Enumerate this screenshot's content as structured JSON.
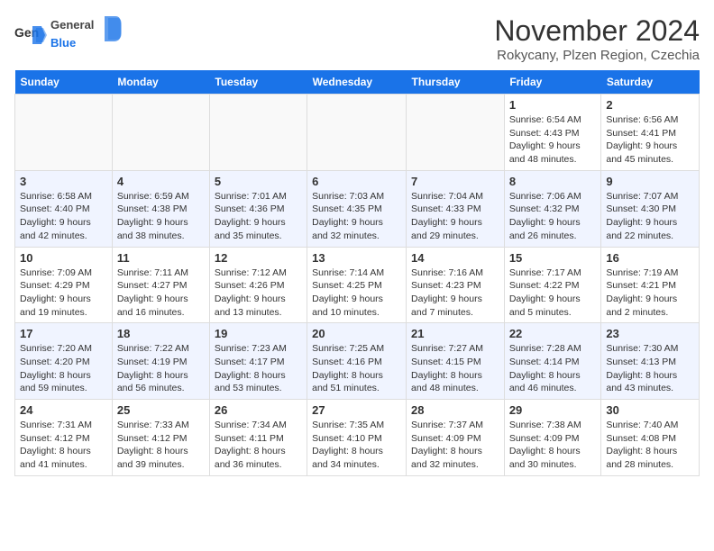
{
  "logo": {
    "general": "General",
    "blue": "Blue"
  },
  "title": "November 2024",
  "location": "Rokycany, Plzen Region, Czechia",
  "days_of_week": [
    "Sunday",
    "Monday",
    "Tuesday",
    "Wednesday",
    "Thursday",
    "Friday",
    "Saturday"
  ],
  "weeks": [
    [
      {
        "day": "",
        "info": ""
      },
      {
        "day": "",
        "info": ""
      },
      {
        "day": "",
        "info": ""
      },
      {
        "day": "",
        "info": ""
      },
      {
        "day": "",
        "info": ""
      },
      {
        "day": "1",
        "info": "Sunrise: 6:54 AM\nSunset: 4:43 PM\nDaylight: 9 hours\nand 48 minutes."
      },
      {
        "day": "2",
        "info": "Sunrise: 6:56 AM\nSunset: 4:41 PM\nDaylight: 9 hours\nand 45 minutes."
      }
    ],
    [
      {
        "day": "3",
        "info": "Sunrise: 6:58 AM\nSunset: 4:40 PM\nDaylight: 9 hours\nand 42 minutes."
      },
      {
        "day": "4",
        "info": "Sunrise: 6:59 AM\nSunset: 4:38 PM\nDaylight: 9 hours\nand 38 minutes."
      },
      {
        "day": "5",
        "info": "Sunrise: 7:01 AM\nSunset: 4:36 PM\nDaylight: 9 hours\nand 35 minutes."
      },
      {
        "day": "6",
        "info": "Sunrise: 7:03 AM\nSunset: 4:35 PM\nDaylight: 9 hours\nand 32 minutes."
      },
      {
        "day": "7",
        "info": "Sunrise: 7:04 AM\nSunset: 4:33 PM\nDaylight: 9 hours\nand 29 minutes."
      },
      {
        "day": "8",
        "info": "Sunrise: 7:06 AM\nSunset: 4:32 PM\nDaylight: 9 hours\nand 26 minutes."
      },
      {
        "day": "9",
        "info": "Sunrise: 7:07 AM\nSunset: 4:30 PM\nDaylight: 9 hours\nand 22 minutes."
      }
    ],
    [
      {
        "day": "10",
        "info": "Sunrise: 7:09 AM\nSunset: 4:29 PM\nDaylight: 9 hours\nand 19 minutes."
      },
      {
        "day": "11",
        "info": "Sunrise: 7:11 AM\nSunset: 4:27 PM\nDaylight: 9 hours\nand 16 minutes."
      },
      {
        "day": "12",
        "info": "Sunrise: 7:12 AM\nSunset: 4:26 PM\nDaylight: 9 hours\nand 13 minutes."
      },
      {
        "day": "13",
        "info": "Sunrise: 7:14 AM\nSunset: 4:25 PM\nDaylight: 9 hours\nand 10 minutes."
      },
      {
        "day": "14",
        "info": "Sunrise: 7:16 AM\nSunset: 4:23 PM\nDaylight: 9 hours\nand 7 minutes."
      },
      {
        "day": "15",
        "info": "Sunrise: 7:17 AM\nSunset: 4:22 PM\nDaylight: 9 hours\nand 5 minutes."
      },
      {
        "day": "16",
        "info": "Sunrise: 7:19 AM\nSunset: 4:21 PM\nDaylight: 9 hours\nand 2 minutes."
      }
    ],
    [
      {
        "day": "17",
        "info": "Sunrise: 7:20 AM\nSunset: 4:20 PM\nDaylight: 8 hours\nand 59 minutes."
      },
      {
        "day": "18",
        "info": "Sunrise: 7:22 AM\nSunset: 4:19 PM\nDaylight: 8 hours\nand 56 minutes."
      },
      {
        "day": "19",
        "info": "Sunrise: 7:23 AM\nSunset: 4:17 PM\nDaylight: 8 hours\nand 53 minutes."
      },
      {
        "day": "20",
        "info": "Sunrise: 7:25 AM\nSunset: 4:16 PM\nDaylight: 8 hours\nand 51 minutes."
      },
      {
        "day": "21",
        "info": "Sunrise: 7:27 AM\nSunset: 4:15 PM\nDaylight: 8 hours\nand 48 minutes."
      },
      {
        "day": "22",
        "info": "Sunrise: 7:28 AM\nSunset: 4:14 PM\nDaylight: 8 hours\nand 46 minutes."
      },
      {
        "day": "23",
        "info": "Sunrise: 7:30 AM\nSunset: 4:13 PM\nDaylight: 8 hours\nand 43 minutes."
      }
    ],
    [
      {
        "day": "24",
        "info": "Sunrise: 7:31 AM\nSunset: 4:12 PM\nDaylight: 8 hours\nand 41 minutes."
      },
      {
        "day": "25",
        "info": "Sunrise: 7:33 AM\nSunset: 4:12 PM\nDaylight: 8 hours\nand 39 minutes."
      },
      {
        "day": "26",
        "info": "Sunrise: 7:34 AM\nSunset: 4:11 PM\nDaylight: 8 hours\nand 36 minutes."
      },
      {
        "day": "27",
        "info": "Sunrise: 7:35 AM\nSunset: 4:10 PM\nDaylight: 8 hours\nand 34 minutes."
      },
      {
        "day": "28",
        "info": "Sunrise: 7:37 AM\nSunset: 4:09 PM\nDaylight: 8 hours\nand 32 minutes."
      },
      {
        "day": "29",
        "info": "Sunrise: 7:38 AM\nSunset: 4:09 PM\nDaylight: 8 hours\nand 30 minutes."
      },
      {
        "day": "30",
        "info": "Sunrise: 7:40 AM\nSunset: 4:08 PM\nDaylight: 8 hours\nand 28 minutes."
      }
    ]
  ]
}
